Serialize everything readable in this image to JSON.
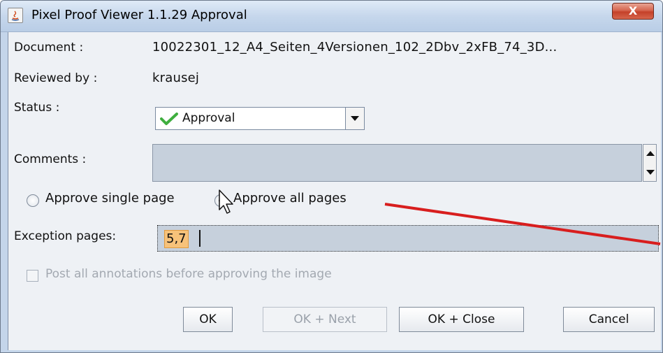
{
  "window": {
    "title": "Pixel Proof Viewer 1.1.29   Approval",
    "close_label": "X"
  },
  "form": {
    "document_label": "Document :",
    "document_value": "10022301_12_A4_Seiten_4Versionen_102_2Dbv_2xFB_74_3D...",
    "reviewed_label": "Reviewed by :",
    "reviewed_value": "krausej",
    "status_label": "Status :",
    "status_value": "Approval",
    "comments_label": "Comments :",
    "comments_value": "",
    "approve_single_label": "Approve single page",
    "approve_all_label": "Approve all pages",
    "selected_mode": "Approve all pages",
    "exception_label": "Exception pages:",
    "exception_value": "5,7",
    "post_annotations_label": "Post all annotations before approving the image",
    "post_annotations_checked": false
  },
  "buttons": {
    "ok": "OK",
    "ok_next": "OK + Next",
    "ok_close": "OK + Close",
    "cancel": "Cancel"
  },
  "colors": {
    "annotation_arrow": "#d81e1e",
    "status_check": "#3fae3f",
    "selection_highlight": "#f7c27a"
  },
  "icons": [
    "java-icon",
    "close-icon",
    "checkmark-icon",
    "chevron-down-icon",
    "scroll-up-icon",
    "scroll-down-icon",
    "mouse-cursor-icon"
  ]
}
